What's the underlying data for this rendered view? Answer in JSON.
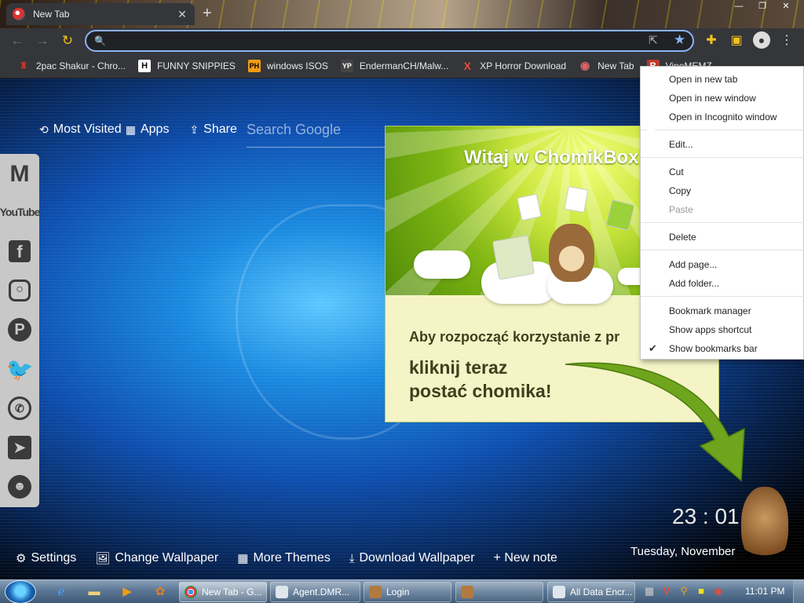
{
  "tab": {
    "title": "New Tab",
    "close": "✕"
  },
  "toolbar": {
    "omnibox_value": ""
  },
  "bookmarks": [
    {
      "label": "2pac Shakur - Chro...",
      "icon_text": "♜",
      "icon_color": "#c0392b"
    },
    {
      "label": "FUNNY SNIPPIES",
      "icon_text": "H",
      "icon_color": "#ffffff"
    },
    {
      "label": "windows ISOS",
      "icon_text": "PH",
      "icon_color": "#f39c12"
    },
    {
      "label": "EndermanCH/Malw...",
      "icon_text": "YP",
      "icon_color": "#444444"
    },
    {
      "label": "XP Horror Download",
      "icon_text": "X",
      "icon_color": "#e74c3c"
    },
    {
      "label": "New Tab",
      "icon_text": "◉",
      "icon_color": "#b33"
    },
    {
      "label": "VineMEMZ",
      "icon_text": "R",
      "icon_color": "#c0392b"
    }
  ],
  "newtab": {
    "most_visited": "Most Visited",
    "apps": "Apps",
    "share": "Share",
    "search_placeholder": "Search Google"
  },
  "social_icons": [
    "gmail-icon",
    "youtube-icon",
    "facebook-icon",
    "instagram-icon",
    "pinterest-icon",
    "twitter-icon",
    "whatsapp-icon",
    "telegram-icon",
    "reddit-icon"
  ],
  "chomikbox": {
    "heading": "Witaj w ChomikBox",
    "line1": "Aby rozpocząć korzystanie z pr",
    "line2": "kliknij teraz",
    "line3": "postać chomika!"
  },
  "clock": {
    "time": "23 : 01",
    "date": "Tuesday, November"
  },
  "bottom_links": {
    "settings": "Settings",
    "change_wallpaper": "Change Wallpaper",
    "more_themes": "More Themes",
    "download_wallpaper": "Download Wallpaper",
    "new_note": "+ New note"
  },
  "context_menu": {
    "open_new_tab": "Open in new tab",
    "open_new_window": "Open in new window",
    "open_incognito": "Open in Incognito window",
    "edit": "Edit...",
    "cut": "Cut",
    "copy": "Copy",
    "paste": "Paste",
    "delete": "Delete",
    "add_page": "Add page...",
    "add_folder": "Add folder...",
    "bookmark_manager": "Bookmark manager",
    "show_apps_shortcut": "Show apps shortcut",
    "show_bookmarks_bar": "Show bookmarks bar"
  },
  "taskbar": {
    "tasks": [
      "New Tab - G...",
      "Agent.DMR...",
      "Login",
      "",
      "All Data Encr..."
    ],
    "time": "11:01 PM"
  },
  "colors": {
    "accent": "#8ab4f8",
    "chrome_dark": "#35363a",
    "chomik_green": "#7fb614"
  }
}
